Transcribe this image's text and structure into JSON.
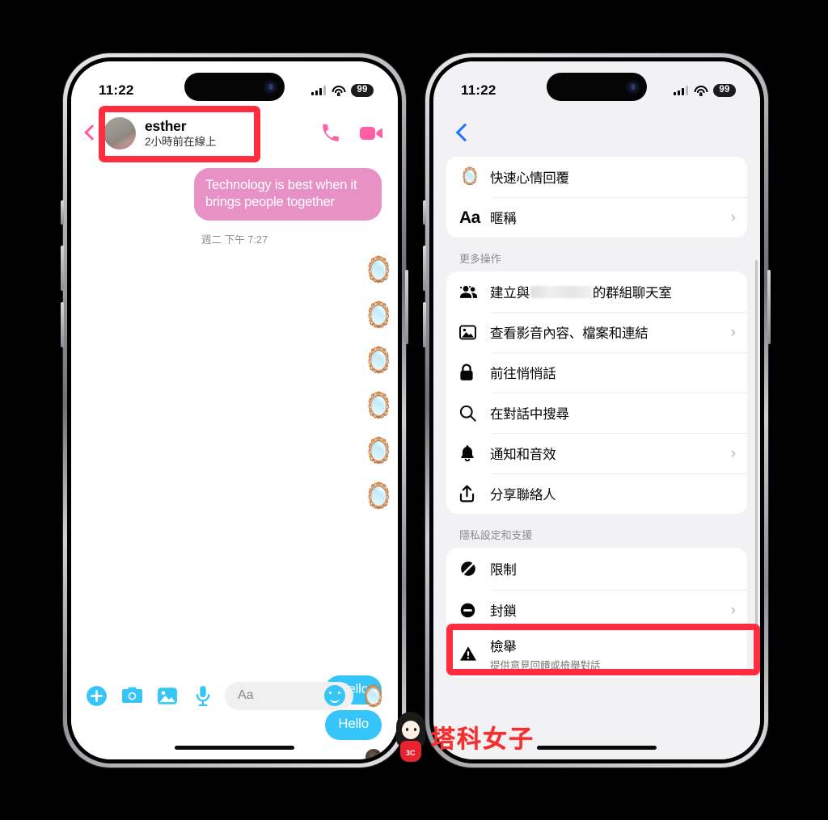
{
  "status_bar": {
    "time": "11:22",
    "battery": "99",
    "signal_icon": "cellular-bars-icon",
    "wifi_icon": "wifi-icon"
  },
  "left_phone": {
    "header": {
      "back_icon": "back-chevron-icon",
      "avatar": "contact-avatar",
      "name": "esther",
      "status": "2小時前在線上",
      "call_icon": "phone-call-icon",
      "video_icon": "video-call-icon"
    },
    "messages": {
      "incoming": "Technology is best when it brings people together",
      "timestamp": "週二 下午 7:27",
      "outgoing": [
        "Hello",
        "Hello"
      ],
      "sticker": "🪞",
      "sticker_count": 6
    },
    "composer": {
      "plus_icon": "add-plus-icon",
      "camera_icon": "camera-icon",
      "gallery_icon": "photo-gallery-icon",
      "mic_icon": "microphone-icon",
      "placeholder": "Aa",
      "emoji_icon": "emoji-smiley-icon",
      "sticker_icon": "🪞"
    }
  },
  "right_phone": {
    "nav": {
      "back_icon": "back-chevron-icon"
    },
    "top_group": [
      {
        "icon": "🪞",
        "icon_name": "mirror-emoji-icon",
        "label": "快速心情回覆",
        "chevron": false
      },
      {
        "icon": "Aa",
        "icon_name": "nickname-aa-icon",
        "label": "暱稱",
        "chevron": true
      }
    ],
    "more_actions": {
      "title": "更多操作",
      "items": [
        {
          "icon_name": "group-people-icon",
          "label_before": "建立與",
          "label_redacted": true,
          "label_after": "的群組聊天室",
          "chevron": false
        },
        {
          "icon_name": "media-image-icon",
          "label": "查看影音內容、檔案和連結",
          "chevron": true
        },
        {
          "icon_name": "lock-icon",
          "label": "前往悄悄話",
          "chevron": false
        },
        {
          "icon_name": "search-icon",
          "label": "在對話中搜尋",
          "chevron": false
        },
        {
          "icon_name": "bell-notification-icon",
          "label": "通知和音效",
          "chevron": true
        },
        {
          "icon_name": "share-contact-icon",
          "label": "分享聯絡人",
          "chevron": false
        }
      ]
    },
    "privacy": {
      "title": "隱私設定和支援",
      "items": [
        {
          "icon_name": "restrict-slash-icon",
          "label": "限制",
          "chevron": false,
          "highlighted": true
        },
        {
          "icon_name": "block-circle-icon",
          "label": "封鎖",
          "chevron": true
        },
        {
          "icon_name": "report-warning-icon",
          "label": "檢舉",
          "sublabel": "提供意見回饋或檢舉對話",
          "chevron": false
        }
      ]
    }
  },
  "watermark": {
    "text": "塔科女子",
    "badge": "3C"
  },
  "colors": {
    "highlight_red": "#ff2d3f",
    "incoming_bubble": "#e891c6",
    "outgoing_bubble": "#35c5f9",
    "ios_blue": "#1a73ff",
    "messenger_pink": "#ff5fa2",
    "settings_bg": "#f2f2f4"
  }
}
